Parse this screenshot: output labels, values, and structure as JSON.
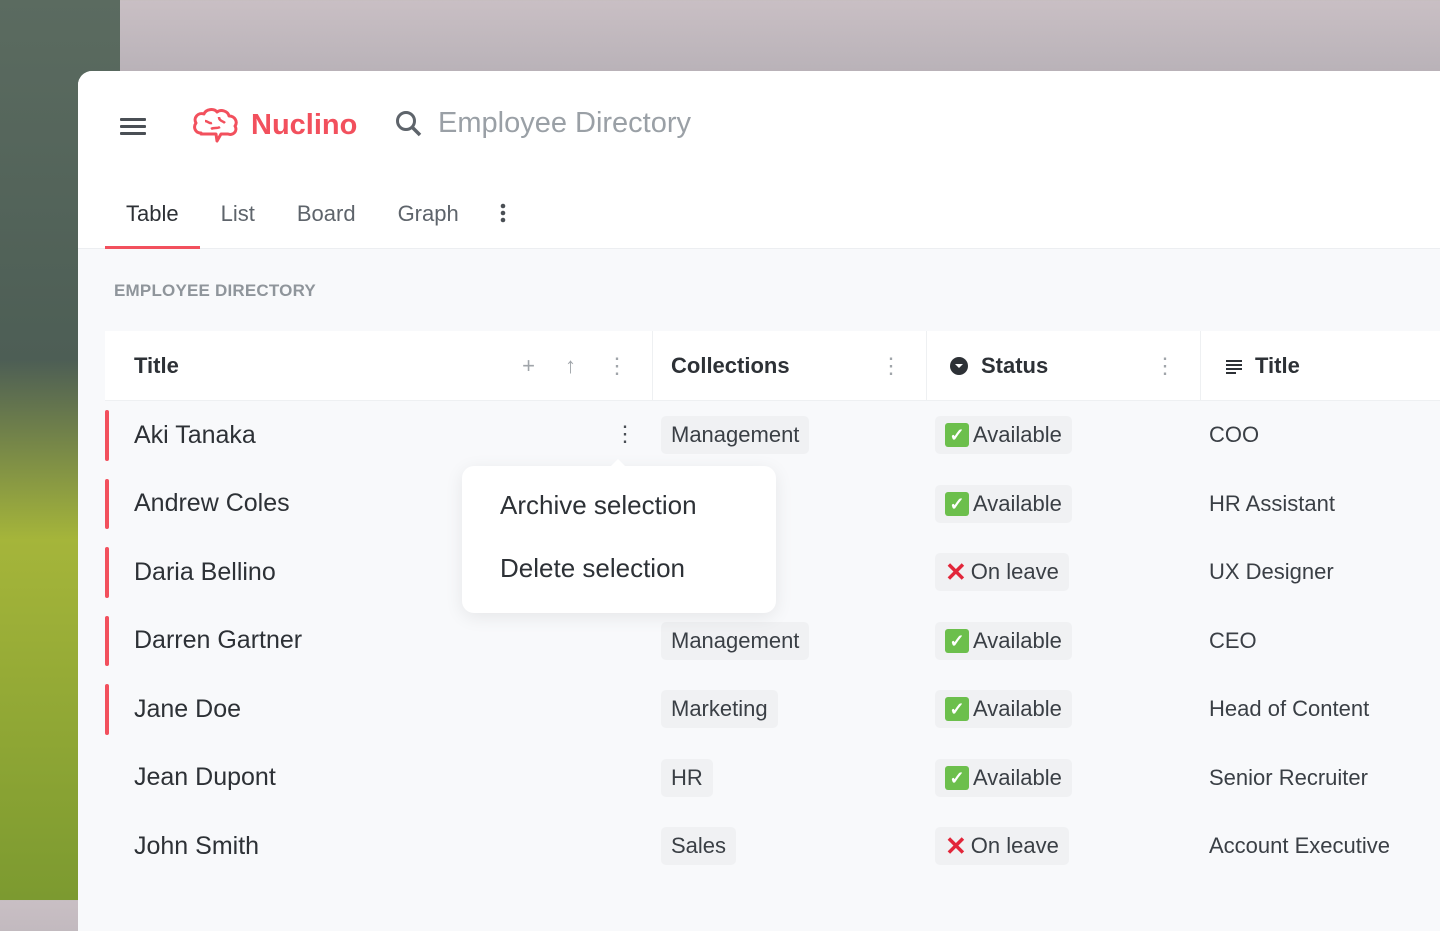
{
  "app": {
    "name": "Nuclino",
    "search_text": "Employee Directory",
    "accent": "#f2505d"
  },
  "tabs": [
    {
      "label": "Table",
      "active": true
    },
    {
      "label": "List"
    },
    {
      "label": "Board"
    },
    {
      "label": "Graph"
    }
  ],
  "section_title": "EMPLOYEE DIRECTORY",
  "columns": [
    {
      "label": "Title"
    },
    {
      "label": "Collections"
    },
    {
      "label": "Status",
      "icon": "status-icon"
    },
    {
      "label": "Title",
      "icon": "text-lines-icon"
    }
  ],
  "rows": [
    {
      "name": "Aki Tanaka",
      "collection": "Management",
      "status": "Available",
      "job": "COO",
      "selected": true
    },
    {
      "name": "Andrew Coles",
      "collection": "",
      "status": "Available",
      "job": "HR Assistant",
      "selected": true
    },
    {
      "name": "Daria Bellino",
      "collection": "",
      "status": "On leave",
      "job": "UX Designer",
      "selected": true
    },
    {
      "name": "Darren Gartner",
      "collection": "Management",
      "status": "Available",
      "job": "CEO",
      "selected": true
    },
    {
      "name": "Jane Doe",
      "collection": "Marketing",
      "status": "Available",
      "job": "Head of Content",
      "selected": true
    },
    {
      "name": "Jean Dupont",
      "collection": "HR",
      "status": "Available",
      "job": "Senior Recruiter",
      "selected": false
    },
    {
      "name": "John Smith",
      "collection": "Sales",
      "status": "On leave",
      "job": "Account Executive",
      "selected": false
    }
  ],
  "context_menu": {
    "items": [
      "Archive selection",
      "Delete selection"
    ]
  }
}
